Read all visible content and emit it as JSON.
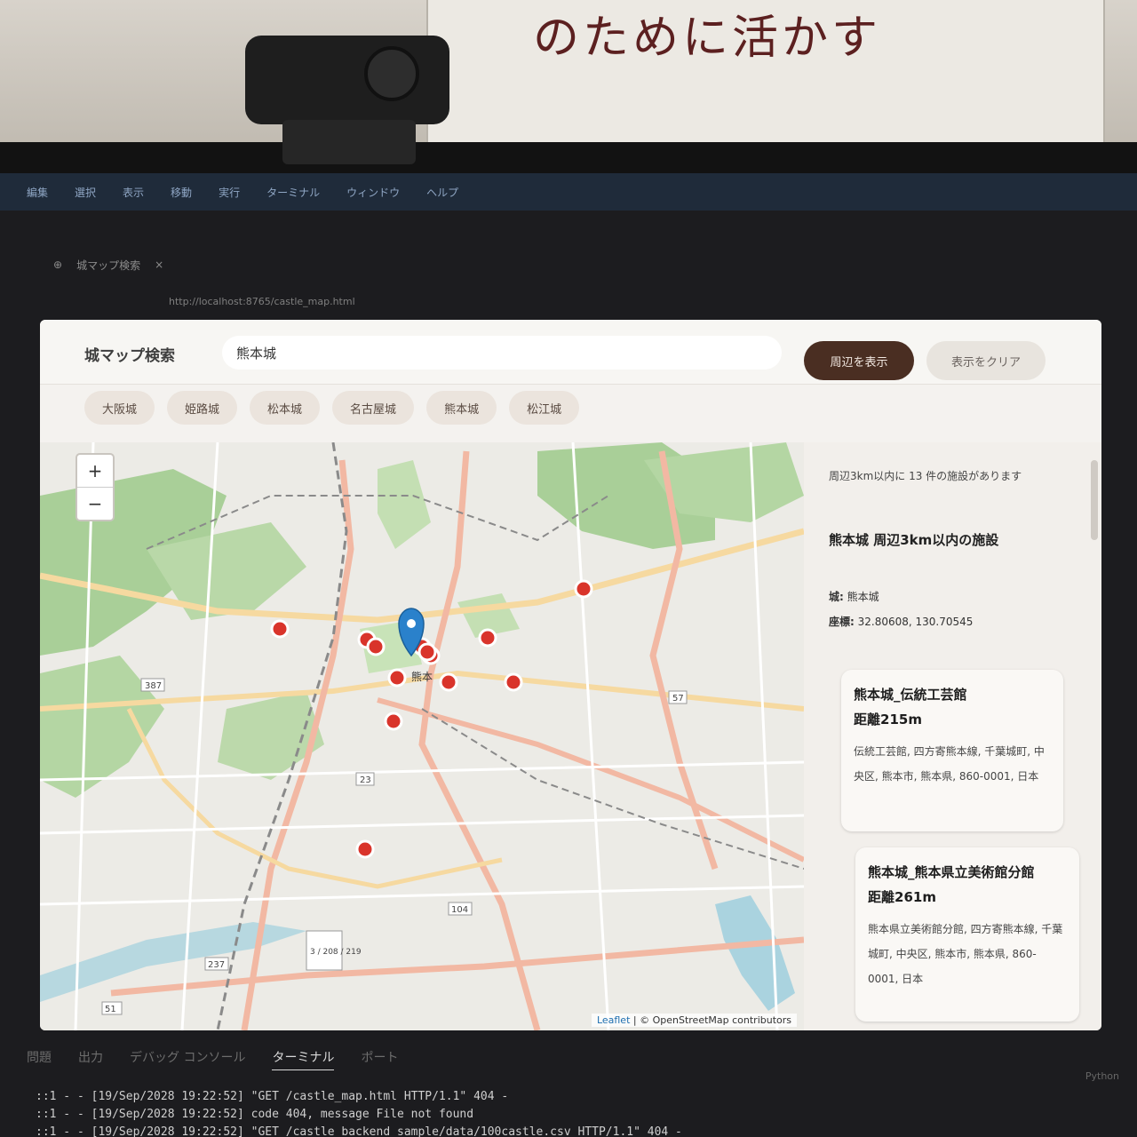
{
  "poster": {
    "text": "のために活かす"
  },
  "editor": {
    "menu": [
      "編集",
      "選択",
      "表示",
      "移動",
      "実行",
      "ターミナル",
      "ウィンドウ",
      "ヘルプ"
    ],
    "tab_title": "城マップ検索",
    "url": "http://localhost:8765/castle_map.html"
  },
  "app": {
    "title": "城マップ検索",
    "search": {
      "value": "熊本城",
      "placeholder": ""
    },
    "show_button": "周辺を表示",
    "clear_button": "表示をクリア",
    "presets": [
      "大阪城",
      "姫路城",
      "松本城",
      "名古屋城",
      "熊本城",
      "松江城"
    ]
  },
  "map": {
    "zoom_in": "+",
    "zoom_out": "−",
    "attribution_leaflet": "Leaflet",
    "attribution_osm": "| © OpenStreetMap contributors",
    "road_numbers": [
      "387",
      "57",
      "23",
      "104",
      "237",
      "51",
      "3 / 208 / 219"
    ],
    "station_label": "熊本",
    "marker_color": "#d9342b",
    "center_marker_color": "#2a81cb"
  },
  "results": {
    "summary": "周辺3km以内に 13 件の施設があります",
    "heading": "熊本城 周辺3km以内の施設",
    "castle_label": "城:",
    "castle_value": "熊本城",
    "coord_label": "座標:",
    "coord_value": "32.80608, 130.70545",
    "cards": [
      {
        "title": "熊本城_伝統工芸館",
        "distance": "215m",
        "address": "伝統工芸館, 四方寄熊本線, 千葉城町, 中央区, 熊本市, 熊本県, 860-0001, 日本"
      },
      {
        "title": "熊本城_熊本県立美術館分館",
        "distance": "261m",
        "address": "熊本県立美術館分館, 四方寄熊本線, 千葉城町, 中央区, 熊本市, 熊本県, 860-0001, 日本"
      }
    ]
  },
  "bottom_panel": {
    "tabs": [
      "問題",
      "出力",
      "デバッグ コンソール",
      "ターミナル",
      "ポート"
    ],
    "active_tab": "ターミナル",
    "language": "Python"
  },
  "terminal": {
    "lines": [
      "::1 - - [19/Sep/2028 19:22:52] \"GET /castle_map.html HTTP/1.1\" 404 -",
      "::1 - - [19/Sep/2028 19:22:52] code 404, message File not found",
      "::1 - - [19/Sep/2028 19:22:52] \"GET /castle_backend_sample/data/100castle.csv HTTP/1.1\" 404 -"
    ]
  }
}
